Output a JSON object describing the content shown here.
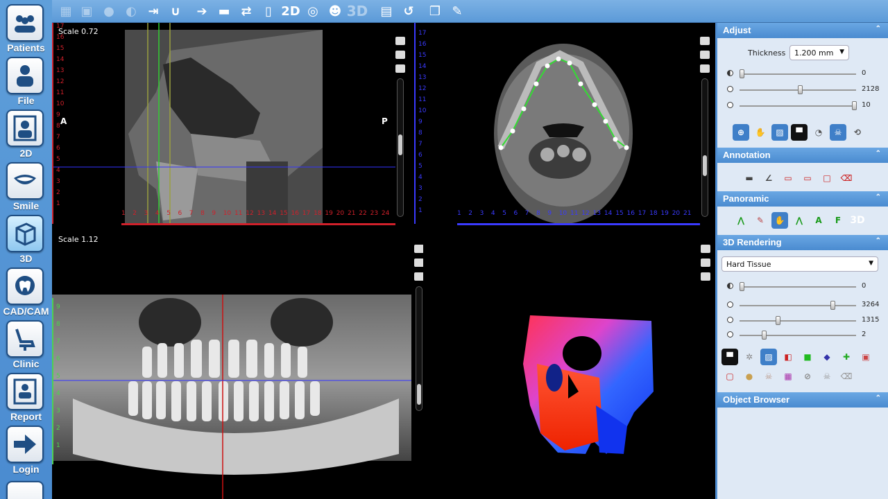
{
  "nav": {
    "items": [
      {
        "label": "Patients"
      },
      {
        "label": "File"
      },
      {
        "label": "2D"
      },
      {
        "label": "Smile"
      },
      {
        "label": "3D"
      },
      {
        "label": "CAD/CAM"
      },
      {
        "label": "Clinic"
      },
      {
        "label": "Report"
      },
      {
        "label": "Login"
      }
    ]
  },
  "toolbar": {
    "mode_2d": "2D",
    "mode_3d": "3D"
  },
  "viewports": {
    "sagittal": {
      "scale": "Scale 0.72",
      "orient_left": "A",
      "orient_right": "P",
      "ruler_v": [
        "17",
        "16",
        "15",
        "14",
        "13",
        "12",
        "11",
        "10",
        "9",
        "8",
        "7",
        "6",
        "5",
        "4",
        "3",
        "2",
        "1"
      ],
      "ruler_h": [
        "1",
        "2",
        "3",
        "4",
        "5",
        "6",
        "7",
        "8",
        "9",
        "10",
        "11",
        "12",
        "13",
        "14",
        "15",
        "16",
        "17",
        "18",
        "19",
        "20",
        "21",
        "22",
        "23",
        "24"
      ]
    },
    "axial": {
      "ruler_v": [
        "17",
        "16",
        "15",
        "14",
        "13",
        "12",
        "11",
        "10",
        "9",
        "8",
        "7",
        "6",
        "5",
        "4",
        "3",
        "2",
        "1"
      ],
      "ruler_h": [
        "1",
        "2",
        "3",
        "4",
        "5",
        "6",
        "7",
        "8",
        "9",
        "10",
        "11",
        "12",
        "13",
        "14",
        "15",
        "16",
        "17",
        "18",
        "19",
        "20",
        "21"
      ]
    },
    "panoramic": {
      "scale": "Scale 1.12",
      "ruler_v": [
        "9",
        "8",
        "7",
        "6",
        "5",
        "4",
        "3",
        "2",
        "1"
      ]
    }
  },
  "panel": {
    "adjust": {
      "title": "Adjust",
      "thickness_label": "Thickness",
      "thickness_value": "1.200 mm",
      "sliders": [
        {
          "value": "0",
          "level": 0.0
        },
        {
          "value": "2128",
          "level": 0.52
        },
        {
          "value": "10",
          "level": 1.0
        }
      ]
    },
    "annotation": {
      "title": "Annotation"
    },
    "panoramic": {
      "title": "Panoramic",
      "label_3d": "3D"
    },
    "rendering": {
      "title": "3D Rendering",
      "preset": "Hard Tissue",
      "sliders": [
        {
          "value": "0",
          "level": 0.0
        },
        {
          "value": "3264",
          "level": 0.81
        },
        {
          "value": "1315",
          "level": 0.32
        },
        {
          "value": "2",
          "level": 0.2
        }
      ]
    },
    "object_browser": {
      "title": "Object Browser"
    }
  },
  "colors": {
    "accent": "#4a8bd0",
    "ruler_red": "#d0202a",
    "ruler_blue": "#3a3aff",
    "ruler_green": "#4fd14f",
    "arch_green": "#33dd33"
  }
}
